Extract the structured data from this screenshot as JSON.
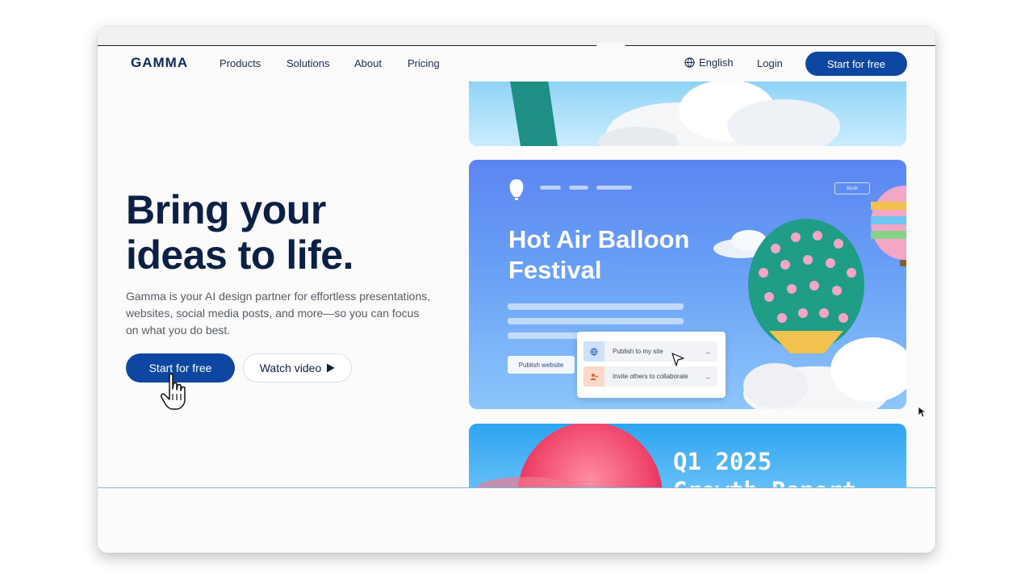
{
  "nav": {
    "logo": "GAMMA",
    "links": [
      "Products",
      "Solutions",
      "About",
      "Pricing"
    ],
    "language": "English",
    "login": "Login",
    "cta": "Start for free"
  },
  "hero": {
    "title_line1": "Bring your",
    "title_line2": "ideas to life.",
    "subtitle": "Gamma is your AI design partner for effortless presentations, websites, social media posts, and more—so you can focus on what you do best.",
    "primary_cta": "Start for free",
    "secondary_cta": "Watch video"
  },
  "showcase": {
    "balloon_card": {
      "title_line1": "Hot Air Balloon",
      "title_line2": "Festival",
      "book_button": "Book",
      "publish_button": "Publish website",
      "menu_items": [
        {
          "label": "Publish to my site",
          "icon": "globe-icon"
        },
        {
          "label": "Invite others to collaborate",
          "icon": "user-add-icon"
        }
      ]
    },
    "report_card": {
      "title": "Q1 2025",
      "subtitle": "Growth Report"
    }
  },
  "colors": {
    "brand_blue": "#0d47a1",
    "heading": "#0c1f45",
    "card_blue": "#5b86f2"
  }
}
